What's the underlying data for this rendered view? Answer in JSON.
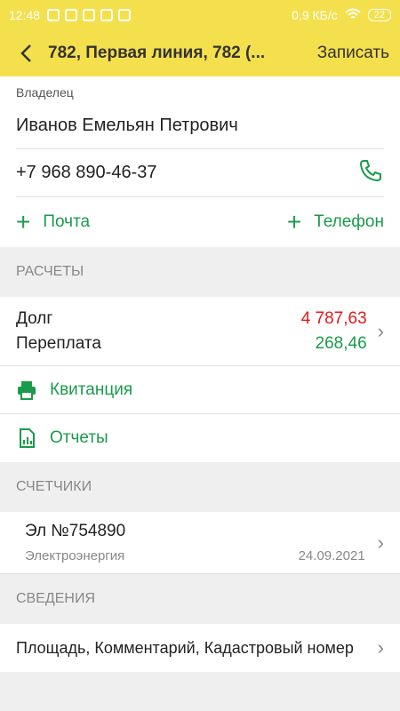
{
  "status_bar": {
    "time": "12:48",
    "speed": "0,9 КБ/с",
    "battery": "22"
  },
  "app_bar": {
    "title": "782, Первая линия, 782 (...",
    "save_label": "Записать"
  },
  "owner": {
    "label": "Владелец",
    "name": "Иванов Емельян Петрович",
    "phone": "+7 968 890-46-37",
    "add_email_label": "Почта",
    "add_phone_label": "Телефон"
  },
  "calculations": {
    "section_title": "РАСЧЕТЫ",
    "debt_label": "Долг",
    "debt_value": "4 787,63",
    "overpay_label": "Переплата",
    "overpay_value": "268,46",
    "receipt_label": "Квитанция",
    "reports_label": "Отчеты"
  },
  "meters": {
    "section_title": "СЧЕТЧИКИ",
    "items": [
      {
        "name": "Эл №754890",
        "type": "Электроэнергия",
        "date": "24.09.2021"
      }
    ]
  },
  "details": {
    "section_title": "СВЕДЕНИЯ",
    "summary": "Площадь, Комментарий, Кадастровый номер"
  },
  "colors": {
    "accent_yellow": "#f4e04d",
    "green": "#1a9b4b",
    "red": "#e01b1b"
  }
}
